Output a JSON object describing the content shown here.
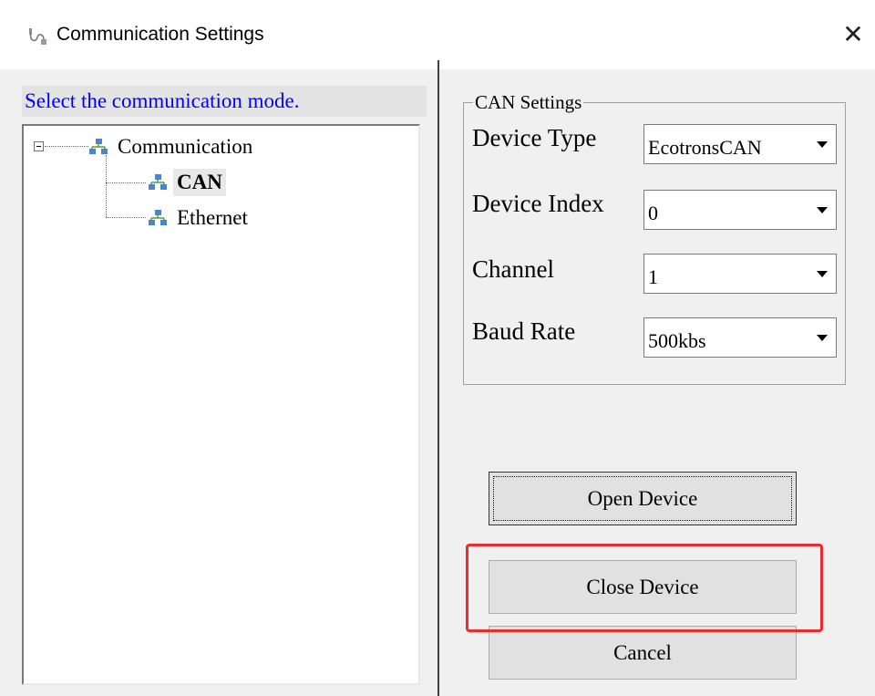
{
  "window": {
    "title": "Communication Settings",
    "icon": "wired-plug-icon",
    "close_label": "✕"
  },
  "left": {
    "instruction": "Select the communication mode.",
    "tree": {
      "root": "Communication",
      "expander": "minus",
      "children": [
        {
          "label": "CAN",
          "selected": true
        },
        {
          "label": "Ethernet",
          "selected": false
        }
      ]
    }
  },
  "can_settings": {
    "legend": "CAN Settings",
    "fields": [
      {
        "label": "Device Type",
        "value": "EcotronsCAN"
      },
      {
        "label": "Device Index",
        "value": "0"
      },
      {
        "label": "Channel",
        "value": "1"
      },
      {
        "label": "Baud Rate",
        "value": "500kbs"
      }
    ]
  },
  "buttons": {
    "open": "Open Device",
    "close": "Close Device",
    "cancel": "Cancel"
  },
  "colors": {
    "instruction_text": "#0000ff",
    "highlight": "#ee2b2b",
    "dialog_bg": "#f0f0f0"
  }
}
